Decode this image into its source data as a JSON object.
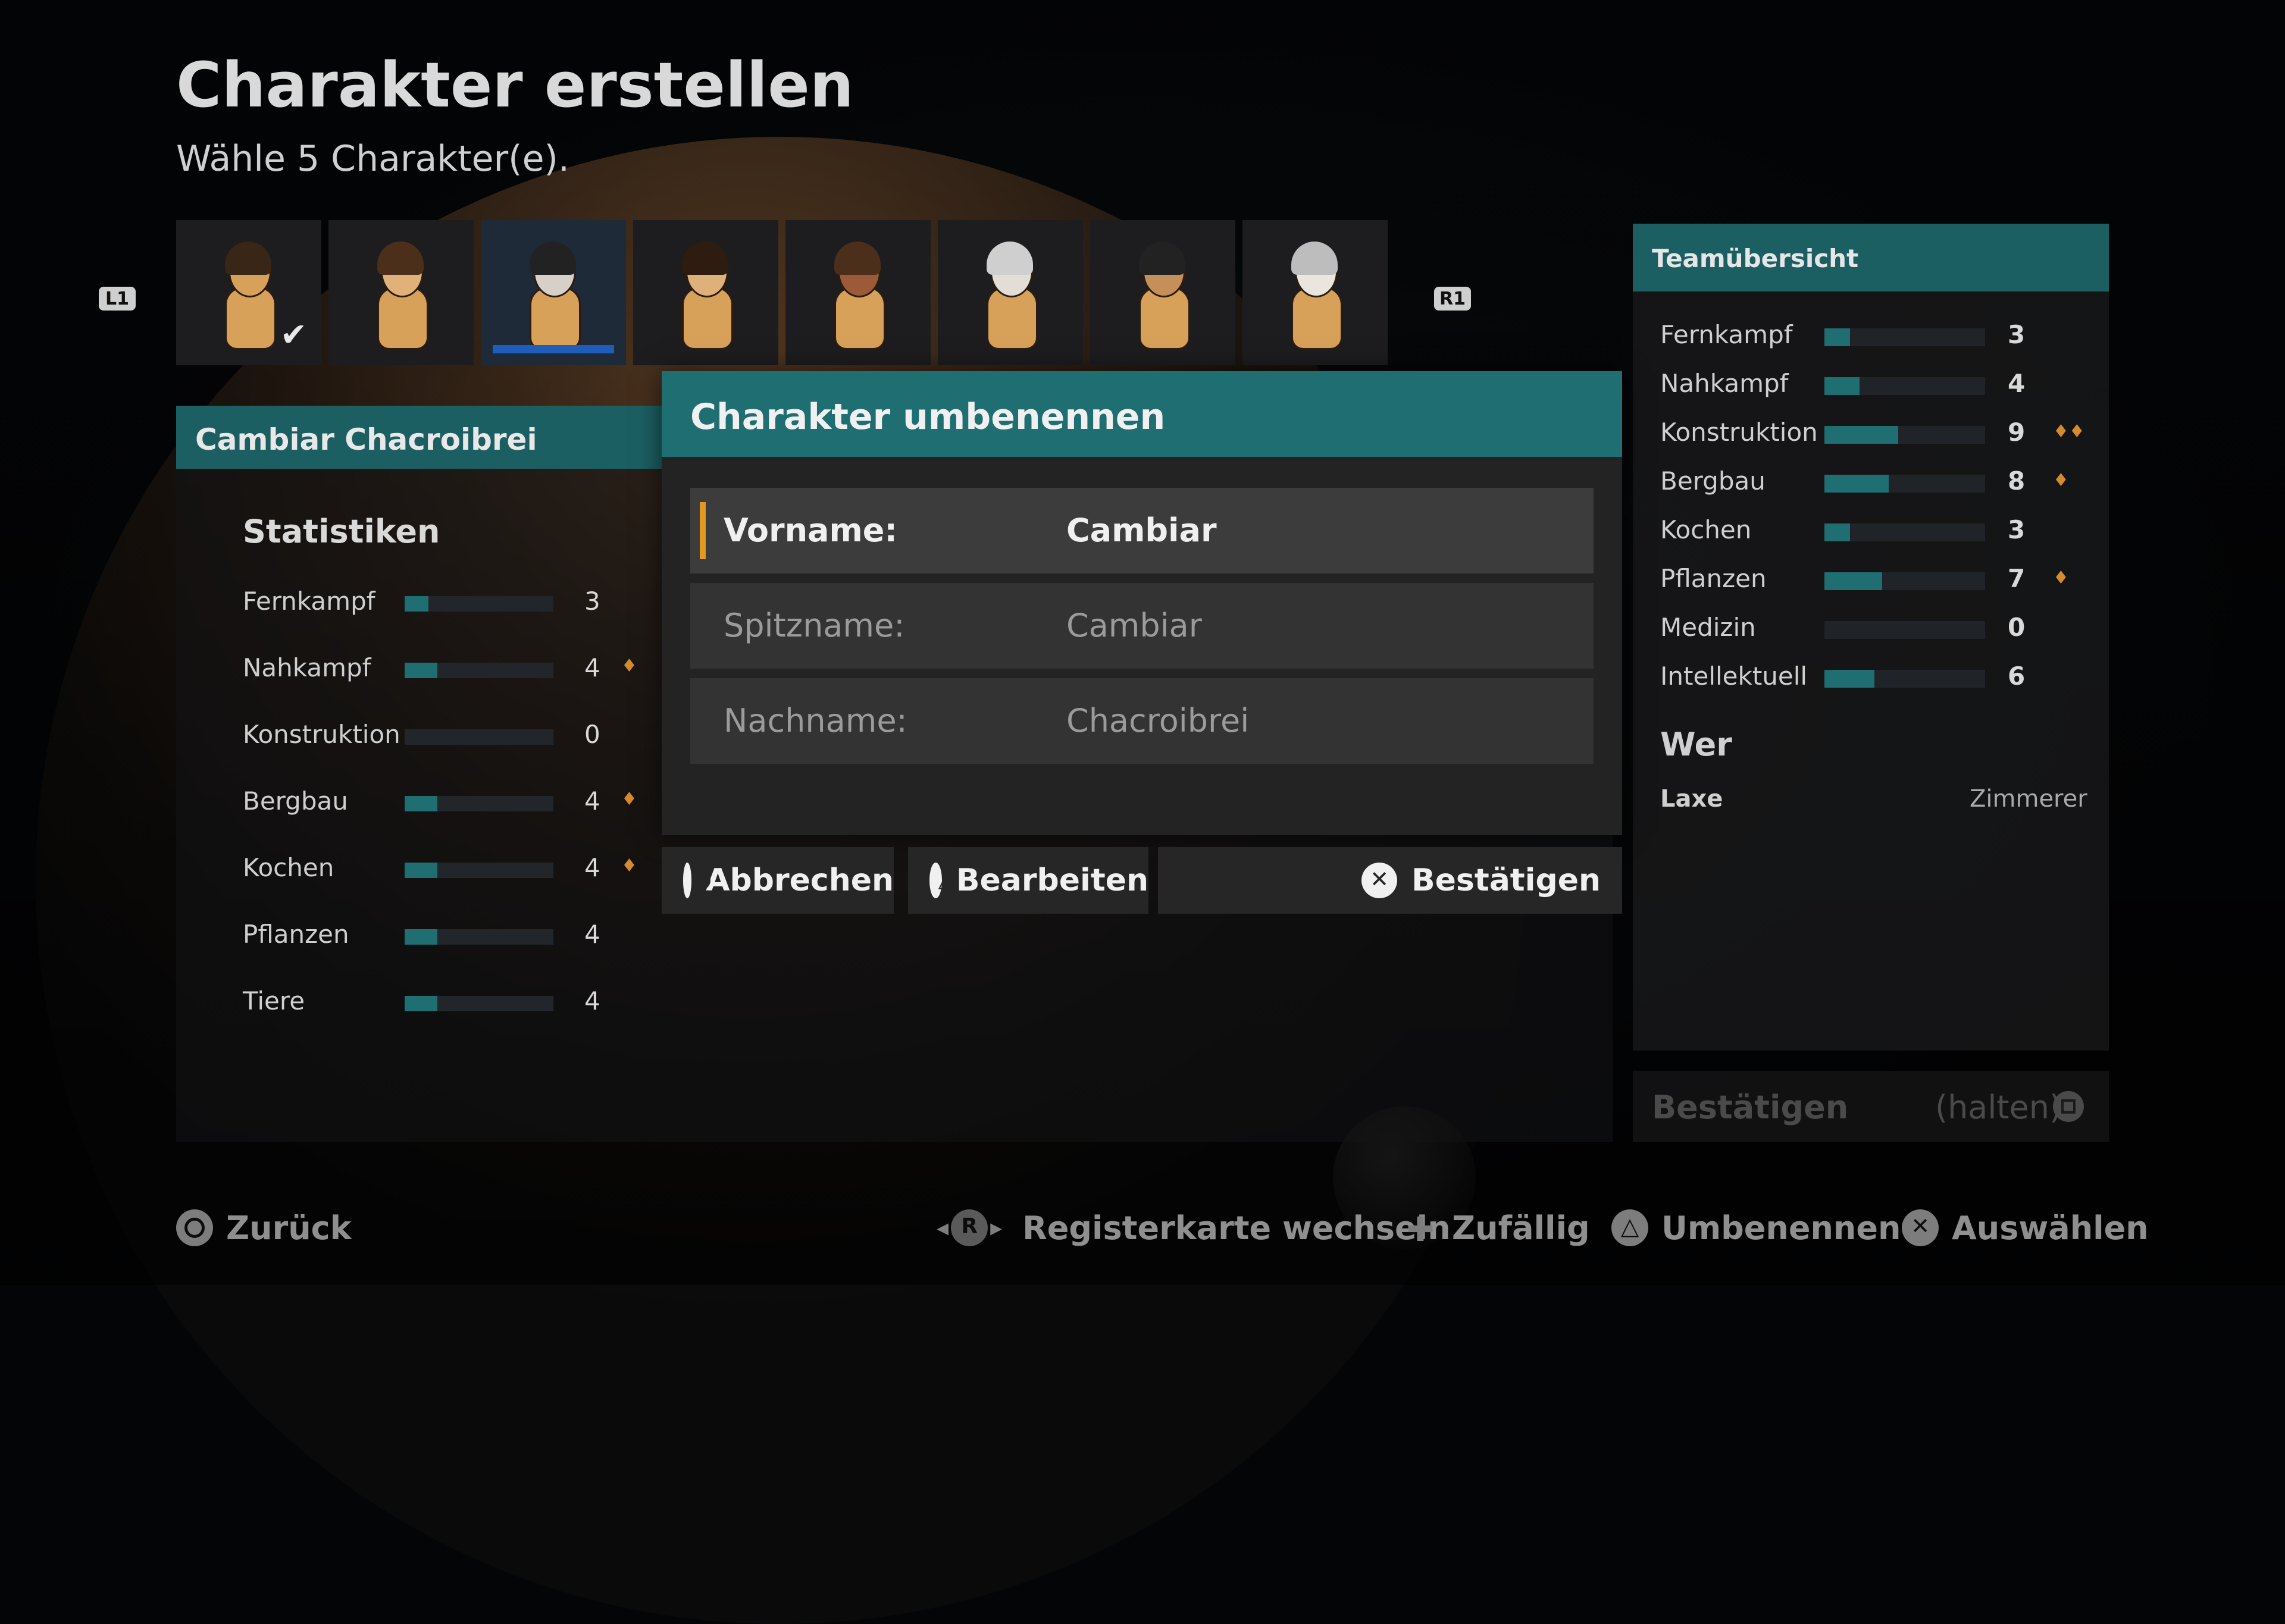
{
  "title": "Charakter erstellen",
  "subtitle": "Wähle 5 Charakter(e).",
  "nav": {
    "left_bumper": "L1",
    "right_bumper": "R1"
  },
  "portraits": [
    {
      "skin": "#d7a15a",
      "hair": "#3a2617",
      "checked": true
    },
    {
      "skin": "#e0b27a",
      "hair": "#4b2f1a",
      "checked": false
    },
    {
      "skin": "#d6d0c8",
      "hair": "#222222",
      "checked": false,
      "selected": true
    },
    {
      "skin": "#deb07a",
      "hair": "#2e1c10",
      "checked": false
    },
    {
      "skin": "#9c5a38",
      "hair": "#4b2f1a",
      "checked": false
    },
    {
      "skin": "#e2ddd6",
      "hair": "#cfcfcf",
      "checked": false
    },
    {
      "skin": "#c58f5a",
      "hair": "#222222",
      "checked": false
    },
    {
      "skin": "#eae5de",
      "hair": "#bdbdbd",
      "checked": false
    }
  ],
  "character_panel": {
    "name": "Cambiar Chacroibrei",
    "stats_heading": "Statistiken",
    "stats": [
      {
        "name": "Fernkampf",
        "value": "3",
        "fill": 0.16,
        "passion": false
      },
      {
        "name": "Nahkampf",
        "value": "4",
        "fill": 0.22,
        "passion": true
      },
      {
        "name": "Konstruktion",
        "value": "0",
        "fill": 0,
        "passion": false
      },
      {
        "name": "Bergbau",
        "value": "4",
        "fill": 0.22,
        "passion": true
      },
      {
        "name": "Kochen",
        "value": "4",
        "fill": 0.22,
        "passion": true
      },
      {
        "name": "Pflanzen",
        "value": "4",
        "fill": 0.22,
        "passion": false
      },
      {
        "name": "Tiere",
        "value": "4",
        "fill": 0.22,
        "passion": false
      }
    ]
  },
  "team_overview": {
    "title": "Teamübersicht",
    "stats": [
      {
        "name": "Fernkampf",
        "value": "3",
        "fill": 0.16,
        "passion": 0
      },
      {
        "name": "Nahkampf",
        "value": "4",
        "fill": 0.22,
        "passion": 0
      },
      {
        "name": "Konstruktion",
        "value": "9",
        "fill": 0.46,
        "passion": 2
      },
      {
        "name": "Bergbau",
        "value": "8",
        "fill": 0.4,
        "passion": 1
      },
      {
        "name": "Kochen",
        "value": "3",
        "fill": 0.16,
        "passion": 0
      },
      {
        "name": "Pflanzen",
        "value": "7",
        "fill": 0.36,
        "passion": 1
      },
      {
        "name": "Medizin",
        "value": "0",
        "fill": 0,
        "passion": 0
      },
      {
        "name": "Intellektuell",
        "value": "6",
        "fill": 0.31,
        "passion": 0
      }
    ],
    "who_heading": "Wer",
    "who_name": "Laxe",
    "who_role": "Zimmerer",
    "confirm_label": "Bestätigen",
    "confirm_hold": "(halten)"
  },
  "dialog": {
    "title": "Charakter umbenennen",
    "fields": [
      {
        "label": "Vorname:",
        "value": "Cambiar",
        "active": true
      },
      {
        "label": "Spitzname:",
        "value": "Cambiar",
        "active": false
      },
      {
        "label": "Nachname:",
        "value": "Chacroibrei",
        "active": false
      }
    ],
    "cancel": "Abbrechen",
    "edit": "Bearbeiten",
    "confirm": "Bestätigen"
  },
  "footer": {
    "back": "Zurück",
    "switch_tab": "Registerkarte wechseln",
    "random": "Zufällig",
    "rename": "Umbenennen",
    "select": "Auswählen"
  },
  "colors": {
    "teal": "#1e6e72",
    "accent": "#e19a1f",
    "selected_bar": "#1f5dbd",
    "passion": "#d38b2e"
  }
}
